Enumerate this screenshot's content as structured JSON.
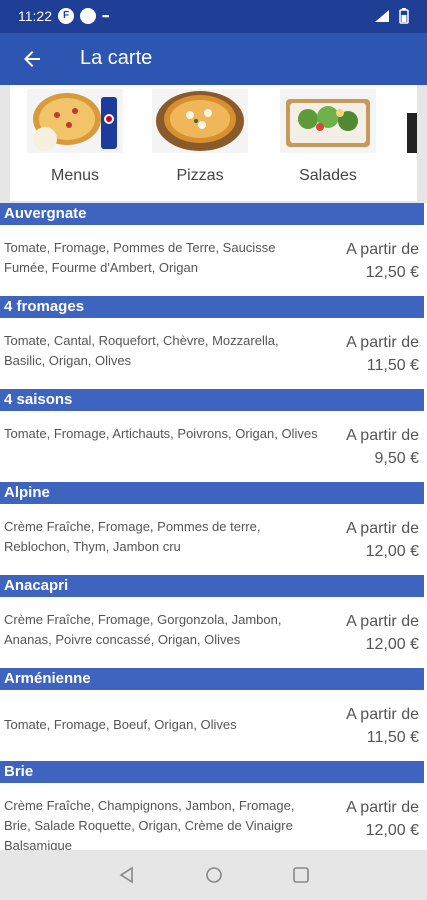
{
  "status_bar": {
    "time": "11:22",
    "badge_letter": "F",
    "extra": "▪▪▪"
  },
  "app_bar": {
    "title": "La carte"
  },
  "categories": [
    {
      "label": "Menus"
    },
    {
      "label": "Pizzas"
    },
    {
      "label": "Salades"
    }
  ],
  "menu_items": [
    {
      "name": "Auvergnate",
      "description": "Tomate, Fromage, Pommes de Terre, Saucisse Fumée, Fourme d'Ambert, Origan",
      "price_prefix": "A partir de",
      "price": "12,50 €"
    },
    {
      "name": "4 fromages",
      "description": "Tomate, Cantal, Roquefort, Chèvre, Mozzarella, Basilic, Origan, Olives",
      "price_prefix": "A partir de",
      "price": "11,50 €"
    },
    {
      "name": "4 saisons",
      "description": "Tomate, Fromage, Artichauts, Poivrons, Origan, Olives",
      "price_prefix": "A partir de",
      "price": "9,50 €"
    },
    {
      "name": "Alpine",
      "description": "Crème Fraîche, Fromage, Pommes de terre, Reblochon, Thym, Jambon cru",
      "price_prefix": "A partir de",
      "price": "12,00 €"
    },
    {
      "name": "Anacapri",
      "description": "Crème Fraîche, Fromage, Gorgonzola, Jambon, Ananas, Poivre concassé, Origan, Olives",
      "price_prefix": "A partir de",
      "price": "12,00 €"
    },
    {
      "name": "Arménienne",
      "description": "Tomate, Fromage, Boeuf, Origan, Olives",
      "price_prefix": "A partir de",
      "price": "11,50 €"
    },
    {
      "name": "Brie",
      "description": "Crème Fraîche, Champignons, Jambon, Fromage, Brie, Salade Roquette, Origan, Crème de Vinaigre Balsamique",
      "price_prefix": "A partir de",
      "price": "12,00 €"
    }
  ],
  "colors": {
    "status_bar": "#1e3f95",
    "app_bar": "#2d56b3",
    "section_header": "#3e64c0"
  }
}
